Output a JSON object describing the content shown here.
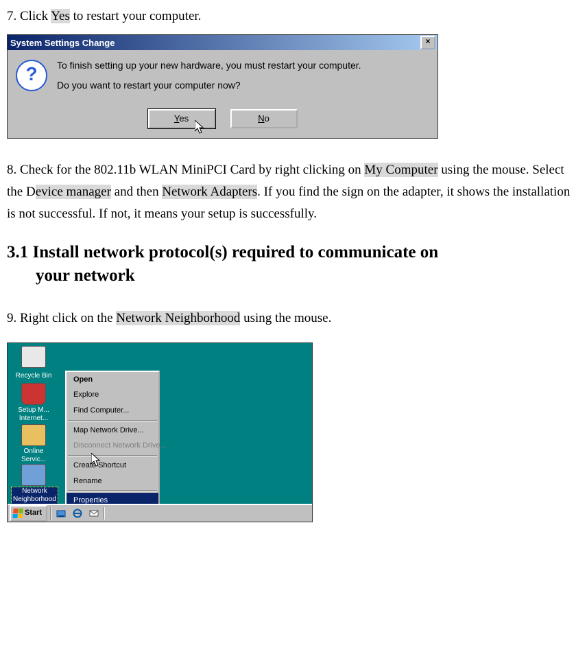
{
  "step7": {
    "prefix": "7. Click ",
    "yes": "Yes",
    "suffix": " to restart your computer."
  },
  "dialog1": {
    "title": "System Settings Change",
    "line1": "To finish setting up your new hardware, you must restart your computer.",
    "line2": "Do you want to restart your computer now?",
    "yes_u": "Y",
    "yes_rest": "es",
    "no_u": "N",
    "no_rest": "o"
  },
  "step8": {
    "a": "8. Check for the 802.11b WLAN MiniPCI Card by right clicking on ",
    "my_computer": "My Computer",
    "b": " using the mouse.    Select the D",
    "device_mgr": "evice manager",
    "c": " and then ",
    "net_adapt": "Network Adapters",
    "d": ".    If you find the sign on the adapter, it shows the installation is not successful. If not, it means your setup is successfully."
  },
  "section31": {
    "line1": "3.1 Install network protocol(s) required to communicate on",
    "line2": "your network"
  },
  "step9": {
    "a": "9. Right click on the ",
    "nn": "Network Neighborhood",
    "b": " using the mouse."
  },
  "desktop": {
    "recycle": "Recycle Bin",
    "msn": "Setup M...\nInternet...",
    "online": "Online\nServic...",
    "netneigh": "Network\nNeighborhood"
  },
  "ctx": {
    "open": "Open",
    "explore": "Explore",
    "find": "Find Computer...",
    "map": "Map Network Drive...",
    "disc": "Disconnect Network Drive...",
    "shortcut": "Create Shortcut",
    "rename": "Rename",
    "props": "Properties"
  },
  "taskbar": {
    "start": "Start"
  }
}
